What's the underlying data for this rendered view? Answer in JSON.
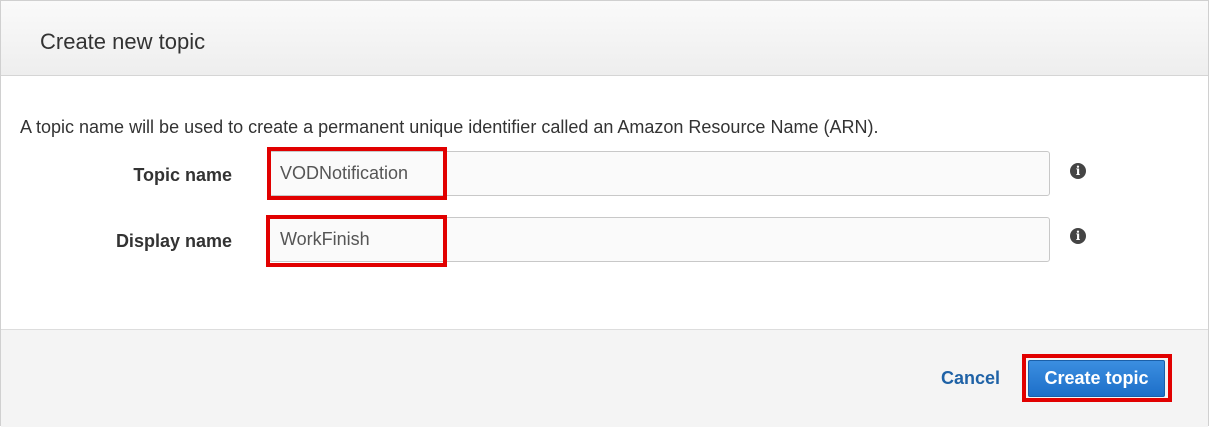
{
  "dialog": {
    "title": "Create new topic",
    "description": "A topic name will be used to create a permanent unique identifier called an Amazon Resource Name (ARN)."
  },
  "form": {
    "topic_name": {
      "label": "Topic name",
      "value": "VODNotification",
      "info_icon": "info-icon"
    },
    "display_name": {
      "label": "Display name",
      "value": "WorkFinish",
      "info_icon": "info-icon"
    }
  },
  "footer": {
    "cancel_label": "Cancel",
    "create_label": "Create topic"
  },
  "colors": {
    "highlight": "#e10000",
    "primary_button": "#1d6fc9",
    "link": "#1f62a6"
  }
}
